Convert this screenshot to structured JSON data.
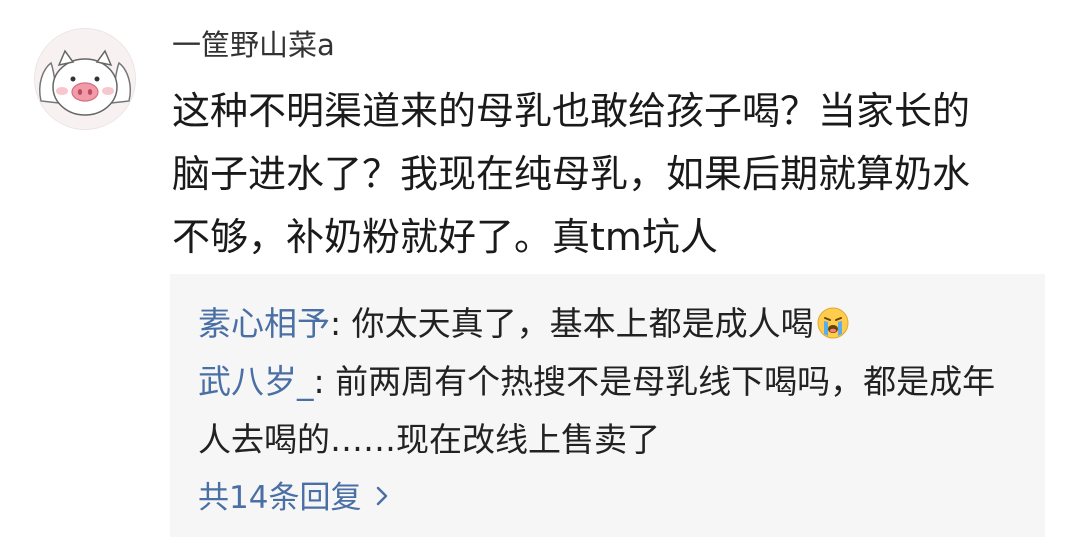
{
  "comment": {
    "avatar_icon": "pig-face-avatar-icon",
    "username": "一筐野山菜a",
    "text": "这种不明渠道来的母乳也敢给孩子喝？当家长的\n脑子进水了？我现在纯母乳，如果后期就算奶水\n不够，补奶粉就好了。真tm坑人"
  },
  "replies": [
    {
      "author": "素心相予",
      "separator": ": ",
      "text": "你太天真了，基本上都是成人喝",
      "emoji": "crying-face-icon"
    },
    {
      "author": "武八岁_",
      "separator": ": ",
      "text": "前两周有个热搜不是母乳线下喝吗，都是成年人去喝的……现在改线上售卖了"
    }
  ],
  "reply_footer": {
    "label": "共14条回复",
    "icon": "chevron-right-icon"
  },
  "colors": {
    "link_blue": "#4a6fa5",
    "reply_background": "#f6f6f6",
    "text_dark": "#1a1a1a",
    "username_gray": "#333333"
  }
}
